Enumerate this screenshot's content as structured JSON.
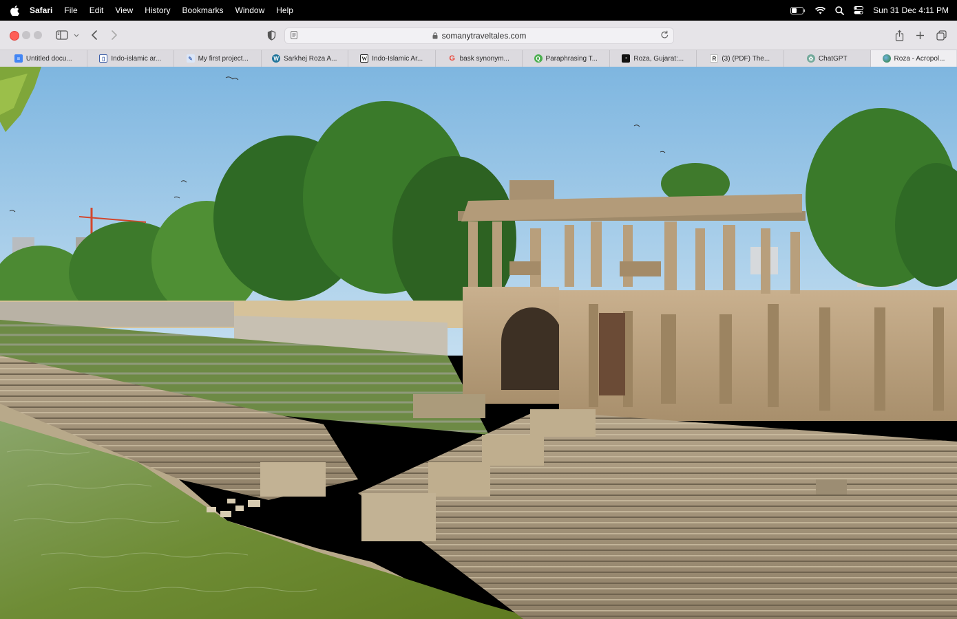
{
  "menubar": {
    "apple_icon": "apple-logo-icon",
    "app_name": "Safari",
    "items": [
      "File",
      "Edit",
      "View",
      "History",
      "Bookmarks",
      "Window",
      "Help"
    ],
    "status_icons": [
      "battery-icon",
      "wifi-icon",
      "spotlight-search-icon",
      "control-center-icon"
    ],
    "clock": "Sun 31 Dec  4:11 PM"
  },
  "toolbar": {
    "sidebar_icon": "sidebar-toggle-icon",
    "back_icon": "chevron-left-icon",
    "forward_icon": "chevron-right-icon",
    "privacy_icon": "privacy-report-shield-icon",
    "address": {
      "url": "somanytraveltales.com"
    },
    "share_icon": "share-icon",
    "new_tab_icon": "plus-icon",
    "tab_overview_icon": "tab-overview-icon"
  },
  "tabs": [
    {
      "title": "Untitled docu...",
      "favicon": "google-docs-icon",
      "color": "#4285f4"
    },
    {
      "title": "Indo-islamic ar...",
      "favicon": "document-icon",
      "color": "#3b5ea8"
    },
    {
      "title": "My first project...",
      "favicon": "project-icon",
      "color": "#8fb1e8"
    },
    {
      "title": "Sarkhej Roza A...",
      "favicon": "wordpress-icon",
      "color": "#21759b"
    },
    {
      "title": "Indo-Islamic Ar...",
      "favicon": "wikipedia-icon",
      "color": "#222222"
    },
    {
      "title": "bask synonym...",
      "favicon": "google-icon",
      "color": "#ea4335"
    },
    {
      "title": "Paraphrasing T...",
      "favicon": "quillbot-icon",
      "color": "#4caf50"
    },
    {
      "title": "Roza, Gujarat:...",
      "favicon": "site-logo-icon",
      "color": "#111111"
    },
    {
      "title": "(3) (PDF) The...",
      "favicon": "researchgate-icon",
      "color": "#ffffff"
    },
    {
      "title": "ChatGPT",
      "favicon": "chatgpt-icon",
      "color": "#74aa9c"
    },
    {
      "title": "Roza - Acropol...",
      "favicon": "globe-icon",
      "color": "#2e7d32",
      "active": true
    }
  ],
  "colors": {
    "close_button": "#fe5f57",
    "sky": "#8fc4e8",
    "foliage": "#3f7a2c",
    "stone": "#b59d7c",
    "water": "#6f8c3a"
  }
}
